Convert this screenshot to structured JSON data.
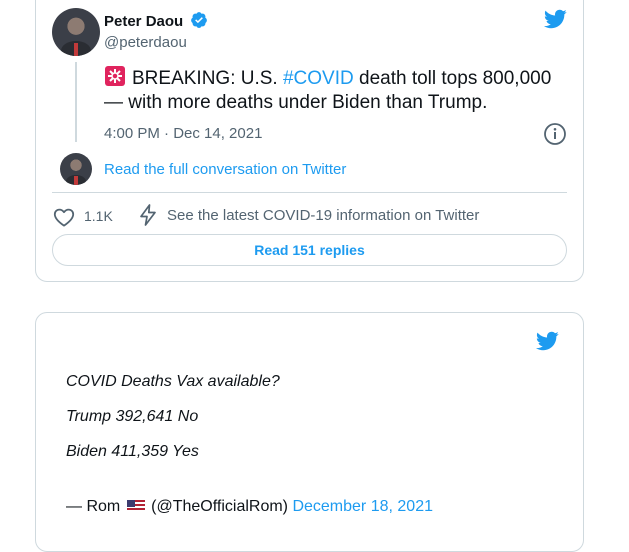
{
  "embed_tweet": {
    "author_name": "Peter Daou",
    "handle": "@peterdaou",
    "icons": {
      "verified": "verified-badge-icon",
      "brand": "twitter-bird-icon",
      "emoji": "police-light-emoji"
    },
    "text_prefix": "BREAKING: U.S. ",
    "hashtag": "#COVID",
    "text_suffix": " death toll tops 800,000 — with more deaths under Biden than Trump.",
    "timestamp": "4:00 PM · Dec 14, 2021",
    "conversation_link": "Read the full conversation on Twitter",
    "like_count": "1.1K",
    "covid_info_link": "See the latest COVID-19 information on Twitter",
    "replies_button": "Read 151 replies",
    "colors": {
      "accent": "#1d9bf0",
      "muted": "#536471",
      "border": "#cfd9de"
    }
  },
  "quoted_tweet": {
    "lines": [
      "COVID Deaths Vax available?",
      "Trump 392,641 No",
      "Biden 411,359 Yes"
    ],
    "attribution_prefix": "— Rom",
    "attribution_handle": "(@TheOfficialRom)",
    "date": "December 18, 2021"
  }
}
